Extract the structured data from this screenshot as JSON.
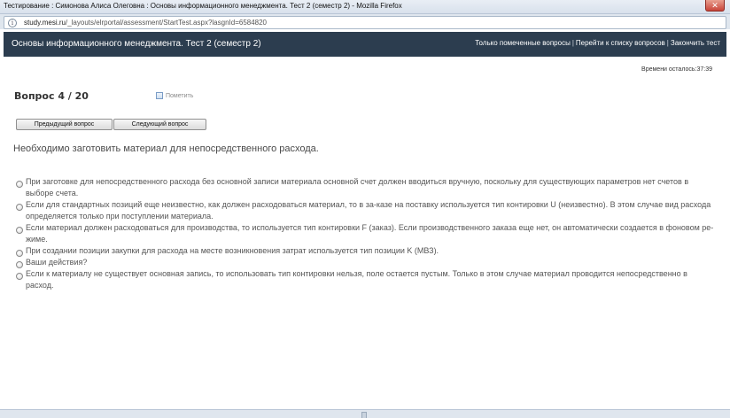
{
  "window": {
    "title": "Тестирование : Симонова Алиса Олеговна : Основы информационного менеджмента. Тест 2 (семестр 2) - Mozilla Firefox",
    "close_glyph": "✕"
  },
  "address_bar": {
    "host": "study.mesi.ru",
    "path": "/_layouts/elrportal/assessment/StartTest.aspx?lasgnId=6584820"
  },
  "header": {
    "title": "Основы информационного менеджмента. Тест 2 (семестр 2)",
    "links": [
      "Только помеченные вопросы",
      "Перейти к списку вопросов",
      "Закончить тест"
    ]
  },
  "timer_text": "Времени осталось:37:39",
  "question": {
    "counter": "Вопрос 4 / 20",
    "mark_label": "Пометить",
    "prev_label": "Предыдущий вопрос",
    "next_label": "Следующий вопрос",
    "text": "Необходимо заготовить материал для непосредственного расхода.",
    "answers": [
      "При заготовке для непосредственного расхода без основной записи материала основной счет должен вводиться вручную, поскольку для существующих параметров нет счетов в выборе счета.",
      "Если для стандартных позиций еще неизвестно, как должен расходоваться материал, то в за-казе на поставку используется тип контировки U (неизвестно). В этом случае вид расхода определяется только при поступлении материала.",
      "Если материал должен расходоваться для производства, то используется тип контировки F (заказ). Если производственного заказа еще нет, он автоматически создается в фоновом ре-жиме.",
      "При создании позиции закупки для расхода на месте возникновения затрат используется тип позиции K (МВЗ).",
      "Ваши действия?",
      "Если к материалу не существует основная запись, то использовать тип контировки нельзя, поле остается пустым. Только в этом случае материал проводится непосредственно в расход."
    ]
  }
}
